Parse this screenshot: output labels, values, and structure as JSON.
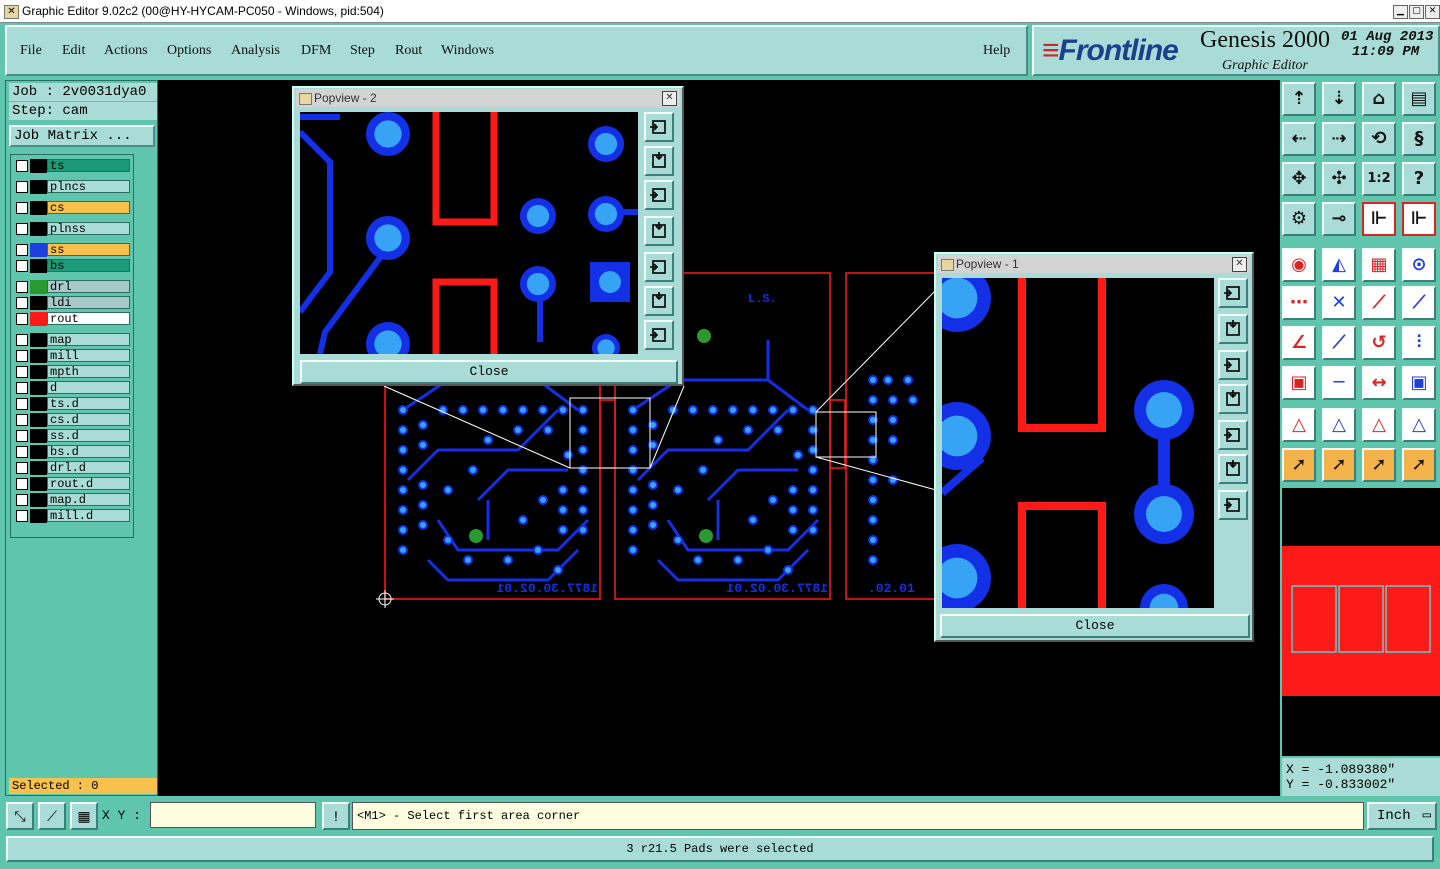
{
  "window": {
    "title": "Graphic Editor 9.02c2 (00@HY-HYCAM-PC050 - Windows, pid:504)",
    "btn_min": "▁",
    "btn_max": "▢",
    "btn_close": "✕"
  },
  "menu": {
    "file": "File",
    "edit": "Edit",
    "actions": "Actions",
    "options": "Options",
    "analysis": "Analysis",
    "dfm": "DFM",
    "step": "Step",
    "rout": "Rout",
    "windows": "Windows",
    "help": "Help"
  },
  "brand": {
    "logo": "Frontline",
    "product": "Genesis 2000",
    "subtitle": "Graphic Editor",
    "date": "01 Aug 2013",
    "time": "11:09 PM"
  },
  "job": {
    "job_line": "Job : 2v0031dya0",
    "step_line": "Step: cam",
    "matrix_button": "Job Matrix ..."
  },
  "layers": [
    {
      "name": "ts",
      "swatch": "#000000",
      "bg": "#1a9a77"
    },
    {
      "name": "plncs",
      "swatch": "#000000",
      "bg": "#a9dcd6"
    },
    {
      "name": "cs",
      "swatch": "#000000",
      "bg": "#f6c14c"
    },
    {
      "name": "plnss",
      "swatch": "#000000",
      "bg": "#a9dcd6"
    },
    {
      "name": "ss",
      "swatch": "#1d3fe0",
      "bg": "#f6c14c"
    },
    {
      "name": "bs",
      "swatch": "#000000",
      "bg": "#1a9a77"
    },
    {
      "name": "drl",
      "swatch": "#2a9a30",
      "bg": "#a9c8c8"
    },
    {
      "name": "ldi",
      "swatch": "#000000",
      "bg": "#a9c8c8"
    },
    {
      "name": "rout",
      "swatch": "#ff1a1a",
      "bg": "#ffffff"
    },
    {
      "name": "map",
      "swatch": "#000000",
      "bg": "#a9dcd6"
    },
    {
      "name": "mill",
      "swatch": "#000000",
      "bg": "#a9dcd6"
    },
    {
      "name": "mpth",
      "swatch": "#000000",
      "bg": "#a9dcd6"
    },
    {
      "name": "d",
      "swatch": "#000000",
      "bg": "#a9dcd6"
    },
    {
      "name": "ts.d",
      "swatch": "#000000",
      "bg": "#a9dcd6"
    },
    {
      "name": "cs.d",
      "swatch": "#000000",
      "bg": "#a9dcd6"
    },
    {
      "name": "ss.d",
      "swatch": "#000000",
      "bg": "#a9dcd6"
    },
    {
      "name": "bs.d",
      "swatch": "#000000",
      "bg": "#a9dcd6"
    },
    {
      "name": "drl.d",
      "swatch": "#000000",
      "bg": "#a9dcd6"
    },
    {
      "name": "rout.d",
      "swatch": "#000000",
      "bg": "#a9dcd6"
    },
    {
      "name": "map.d",
      "swatch": "#000000",
      "bg": "#a9dcd6"
    },
    {
      "name": "mill.d",
      "swatch": "#000000",
      "bg": "#a9dcd6"
    }
  ],
  "selected": "Selected : 0",
  "popview2": {
    "title": "Popview - 2",
    "close": "Close"
  },
  "popview1": {
    "title": "Popview - 1",
    "close": "Close"
  },
  "board": {
    "label": "1877.30.02.01",
    "mark": "L.S."
  },
  "coords": {
    "x": "X = -1.089380\"",
    "y": "Y = -0.833002\""
  },
  "command": {
    "xy_label": "X Y :",
    "xy_value": "",
    "prompt": "<M1> - Select first area corner",
    "units": "Inch"
  },
  "status": "3 r21.5 Pads were selected",
  "colors": {
    "copper": "#1330e6",
    "pad": "#36a3f5",
    "rout": "#ff1a1a",
    "drill": "#2a9a30"
  }
}
